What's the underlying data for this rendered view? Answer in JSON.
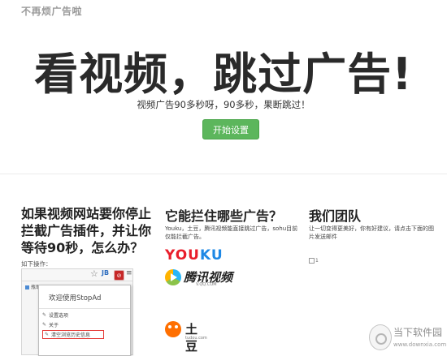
{
  "site": {
    "name": "不再烦广告啦"
  },
  "hero": {
    "title": "看视频，跳过广告!",
    "subtitle": "视频广告90多秒呀，90多秒，果断跳过！",
    "start_button": "开始设置"
  },
  "col1": {
    "heading": "如果视频网站要你停止拦截广告插件，并让你等待90秒，怎么办？",
    "op_label": "如下操作：",
    "browser": {
      "toolbar_jb": "JB",
      "bookmark": "瓶耶Ad",
      "popup_title": "欢迎使用StopAd",
      "menu_items": [
        "设置选项",
        "关于",
        "清空浏览历史信息"
      ]
    }
  },
  "col2": {
    "heading": "它能拦住哪些广告？",
    "description": "Youku，土豆，腾讯视频能直接跳过广告，sohu目前仅能拦截广告。",
    "logos": {
      "youku": "YOUKU",
      "qq_video": "腾讯视频",
      "qq_url": "V.QQ.COM",
      "tudou": "土豆",
      "tudou_url": "tudou.com"
    }
  },
  "col3": {
    "heading": "我们团队",
    "description": "让一切变得更美好，你有好建议，请点击下面的图片发送邮件",
    "image_alt": "1"
  },
  "watermark": {
    "name": "当下软件园",
    "url": "www.downxia.com"
  },
  "colors": {
    "accent_green": "#5cb65c",
    "youku_red": "#e91e2b",
    "youku_blue": "#1e88e5",
    "tudou_orange": "#ff6f00"
  }
}
